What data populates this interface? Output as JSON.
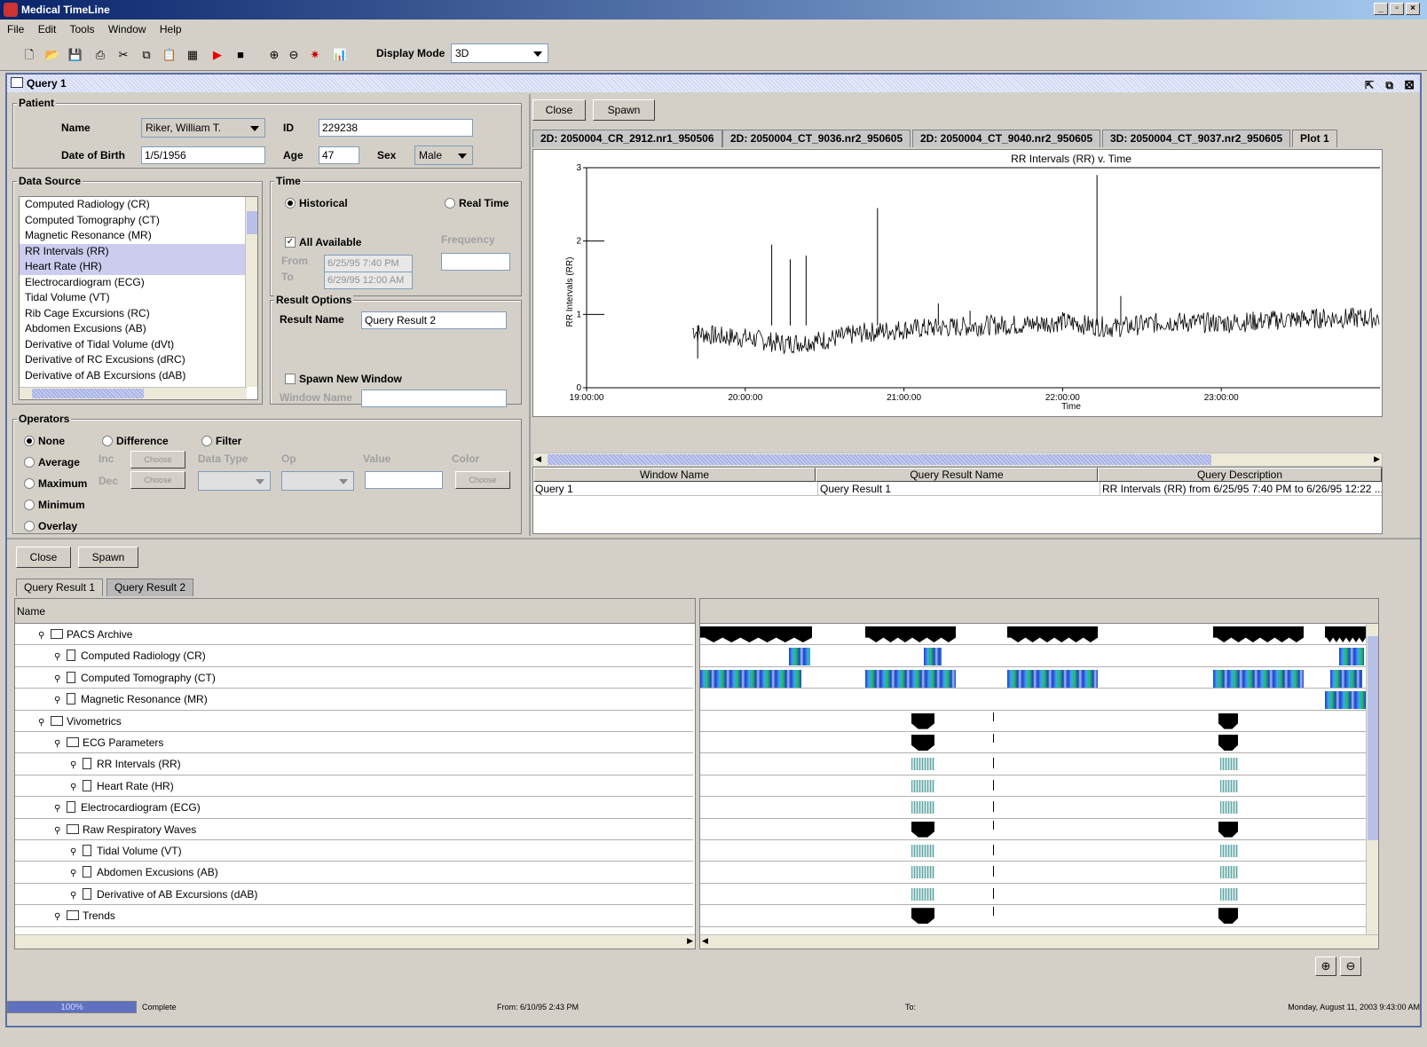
{
  "app": {
    "title": "Medical TimeLine"
  },
  "menu": [
    "File",
    "Edit",
    "Tools",
    "Window",
    "Help"
  ],
  "toolbar": {
    "display_mode_label": "Display Mode",
    "display_mode_value": "3D"
  },
  "query_window": {
    "title": "Query 1"
  },
  "patient": {
    "group_label": "Patient",
    "name_label": "Name",
    "name_value": "Riker, William T.",
    "id_label": "ID",
    "id_value": "229238",
    "dob_label": "Date of Birth",
    "dob_value": "1/5/1956",
    "age_label": "Age",
    "age_value": "47",
    "sex_label": "Sex",
    "sex_value": "Male"
  },
  "data_source": {
    "group_label": "Data Source",
    "items": [
      "Computed Radiology (CR)",
      "Computed Tomography (CT)",
      "Magnetic Resonance (MR)",
      "RR Intervals (RR)",
      "Heart Rate (HR)",
      "Electrocardiogram (ECG)",
      "Tidal Volume (VT)",
      "Rib Cage Excursions (RC)",
      "Abdomen Excusions (AB)",
      "Derivative of Tidal Volume (dVt)",
      "Derivative of RC Excusions (dRC)",
      "Derivative of AB Excursions (dAB)"
    ],
    "selected": [
      3,
      4
    ]
  },
  "time": {
    "group_label": "Time",
    "historical": "Historical",
    "realtime": "Real Time",
    "all_available": "All Available",
    "frequency": "Frequency",
    "from_label": "From",
    "from_value": "6/25/95 7:40 PM",
    "to_label": "To",
    "to_value": "6/29/95 12:00 AM"
  },
  "result_options": {
    "group_label": "Result Options",
    "result_name_label": "Result Name",
    "result_name_value": "Query Result 2",
    "spawn_new_window": "Spawn New Window",
    "window_name_label": "Window Name"
  },
  "operators": {
    "group_label": "Operators",
    "none": "None",
    "difference": "Difference",
    "filter": "Filter",
    "average": "Average",
    "maximum": "Maximum",
    "minimum": "Minimum",
    "overlay": "Overlay",
    "inc": "Inc",
    "dec": "Dec",
    "choose": "Choose",
    "data_type": "Data Type",
    "op": "Op",
    "value": "Value",
    "color": "Color"
  },
  "plot_panel": {
    "close": "Close",
    "spawn": "Spawn",
    "tabs": [
      "2D: 2050004_CR_2912.nr1_950506",
      "2D: 2050004_CT_9036.nr2_950605",
      "2D: 2050004_CT_9040.nr2_950605",
      "3D: 2050004_CT_9037.nr2_950605",
      "Plot 1"
    ],
    "table_headers": [
      "Window Name",
      "Query Result Name",
      "Query Description"
    ],
    "table_rows": [
      [
        "Query 1",
        "Query Result 1",
        "RR Intervals (RR) from 6/25/95 7:40 PM to 6/26/95 12:22 ..."
      ]
    ]
  },
  "chart_data": {
    "type": "line",
    "title": "RR Intervals (RR) v. Time",
    "xlabel": "Time",
    "ylabel": "RR Intervals (RR)",
    "x_ticks": [
      "19:00:00",
      "20:00:00",
      "21:00:00",
      "22:00:00",
      "23:00:00"
    ],
    "y_ticks": [
      "0",
      "1",
      "2",
      "3"
    ],
    "ylim": [
      0,
      3
    ],
    "xlim": [
      "19:00:00",
      "24:00:00"
    ],
    "series": [
      {
        "values_desc": "noisy RR intervals",
        "x": [
          "19:40",
          "19:42",
          "19:50",
          "20:00",
          "20:15",
          "20:30",
          "20:45",
          "21:00",
          "21:15",
          "21:30",
          "21:45",
          "22:00",
          "22:10",
          "22:20",
          "22:40",
          "23:00",
          "23:20",
          "23:40",
          "24:00"
        ],
        "values": [
          0.8,
          0.75,
          0.7,
          0.68,
          0.6,
          0.65,
          0.75,
          0.8,
          0.82,
          0.85,
          0.86,
          0.9,
          0.85,
          0.82,
          0.9,
          0.88,
          0.92,
          0.95,
          0.95
        ]
      }
    ],
    "spikes": [
      {
        "x": "19:42",
        "y": 0.4
      },
      {
        "x": "20:10",
        "y": 1.95
      },
      {
        "x": "20:17",
        "y": 1.75
      },
      {
        "x": "20:23",
        "y": 1.8
      },
      {
        "x": "20:50",
        "y": 2.45
      },
      {
        "x": "21:13",
        "y": 1.15
      },
      {
        "x": "21:25",
        "y": 1.05
      },
      {
        "x": "22:13",
        "y": 2.9
      },
      {
        "x": "22:22",
        "y": 1.25
      }
    ]
  },
  "results": {
    "close": "Close",
    "spawn": "Spawn",
    "tabs": [
      "Query Result 1",
      "Query Result 2"
    ],
    "column_name": "Name",
    "tree": [
      {
        "label": "PACS Archive",
        "depth": 1,
        "type": "folder"
      },
      {
        "label": "Computed Radiology (CR)",
        "depth": 2,
        "type": "doc"
      },
      {
        "label": "Computed Tomography (CT)",
        "depth": 2,
        "type": "doc"
      },
      {
        "label": "Magnetic Resonance (MR)",
        "depth": 2,
        "type": "doc"
      },
      {
        "label": "Vivometrics",
        "depth": 1,
        "type": "folder"
      },
      {
        "label": "ECG Parameters",
        "depth": 2,
        "type": "folder"
      },
      {
        "label": "RR Intervals (RR)",
        "depth": 3,
        "type": "doc"
      },
      {
        "label": "Heart Rate (HR)",
        "depth": 3,
        "type": "doc"
      },
      {
        "label": "Electrocardiogram (ECG)",
        "depth": 2,
        "type": "doc"
      },
      {
        "label": "Raw Respiratory Waves",
        "depth": 2,
        "type": "folder"
      },
      {
        "label": "Tidal Volume (VT)",
        "depth": 3,
        "type": "doc"
      },
      {
        "label": "Abdomen Excusions (AB)",
        "depth": 3,
        "type": "doc"
      },
      {
        "label": "Derivative of AB Excursions (dAB)",
        "depth": 3,
        "type": "doc"
      },
      {
        "label": "Trends",
        "depth": 2,
        "type": "folder"
      }
    ]
  },
  "status": {
    "progress": "100%",
    "state": "Complete",
    "from": "From:  6/10/95 2:43 PM",
    "to": "To:",
    "datetime": "Monday, August 11, 2003 9:43:00 AM"
  }
}
